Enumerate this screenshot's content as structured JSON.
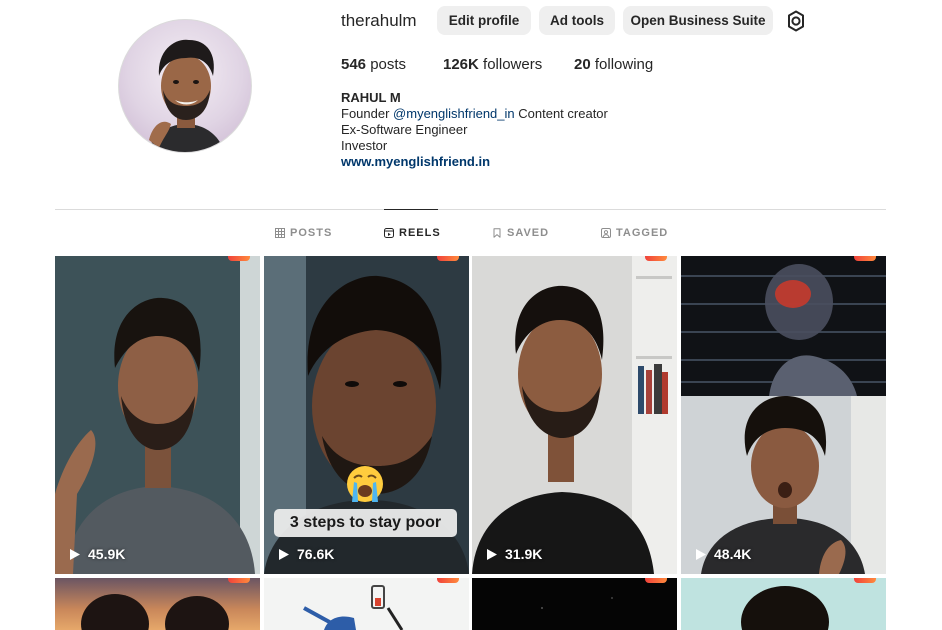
{
  "profile": {
    "username": "therahulm",
    "buttons": {
      "edit": "Edit profile",
      "ad": "Ad tools",
      "suite": "Open Business Suite"
    },
    "stats": {
      "posts_count": "546",
      "posts_label": "posts",
      "followers_count": "126K",
      "followers_label": "followers",
      "following_count": "20",
      "following_label": "following"
    },
    "bio": {
      "name": "RAHUL M",
      "line1_prefix": "Founder",
      "line1_mention": "@myenglishfriend_in",
      "line1_suffix": "Content creator",
      "line2": "Ex-Software Engineer",
      "line3": "Investor",
      "link": "www.myenglishfriend.in"
    }
  },
  "tabs": [
    {
      "label": "POSTS",
      "icon": "grid-icon",
      "active": false
    },
    {
      "label": "REELS",
      "icon": "reels-icon",
      "active": true
    },
    {
      "label": "SAVED",
      "icon": "bookmark-icon",
      "active": false
    },
    {
      "label": "TAGGED",
      "icon": "tagged-icon",
      "active": false
    }
  ],
  "reels": [
    {
      "views": "45.9K",
      "caption": ""
    },
    {
      "views": "76.6K",
      "caption": "3 steps to stay poor",
      "emoji": "crying-face"
    },
    {
      "views": "31.9K",
      "caption": ""
    },
    {
      "views": "48.4K",
      "caption": ""
    }
  ],
  "colors": {
    "link": "#00376b",
    "button_bg": "#efefef",
    "divider": "#dbdbdb",
    "badge": "#f0423b"
  }
}
